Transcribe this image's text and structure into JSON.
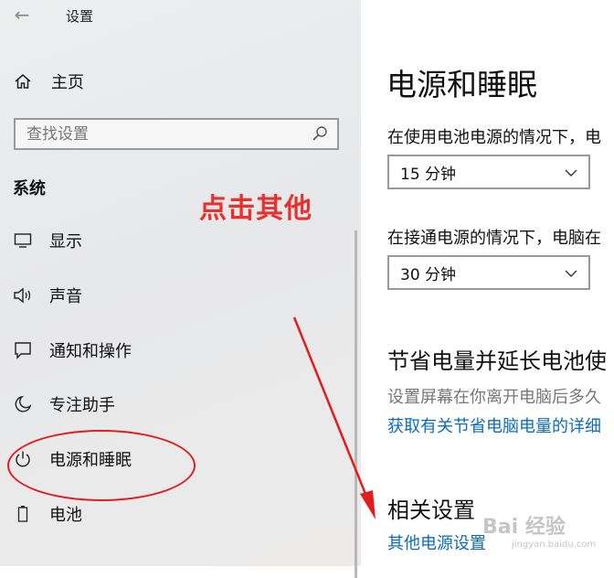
{
  "header": {
    "title": "设置"
  },
  "sidebar": {
    "home_label": "主页",
    "search": {
      "placeholder": "查找设置"
    },
    "section": "系统",
    "items": [
      {
        "label": "显示",
        "icon": "display-icon"
      },
      {
        "label": "声音",
        "icon": "speaker-icon"
      },
      {
        "label": "通知和操作",
        "icon": "notification-icon"
      },
      {
        "label": "专注助手",
        "icon": "moon-icon"
      },
      {
        "label": "电源和睡眠",
        "icon": "power-icon"
      },
      {
        "label": "电池",
        "icon": "battery-icon"
      }
    ]
  },
  "annotation": {
    "text": "点击其他",
    "color": "#e8312f"
  },
  "main": {
    "title": "电源和睡眠",
    "battery_label": "在使用电池电源的情况下，电",
    "battery_value": "15 分钟",
    "plugged_label": "在接通电源的情况下，电脑在",
    "plugged_value": "30 分钟",
    "save_title": "节省电量并延长电池使",
    "save_desc": "设置屏幕在你离开电脑后多久",
    "save_link": "获取有关节省电脑电量的详细",
    "related_title": "相关设置",
    "related_link": "其他电源设置"
  },
  "watermark": {
    "text": "Bai 经验",
    "url": "jingyan.baidu.com"
  },
  "colors": {
    "link": "#0b6cbd",
    "highlight": "#e11d1d"
  }
}
